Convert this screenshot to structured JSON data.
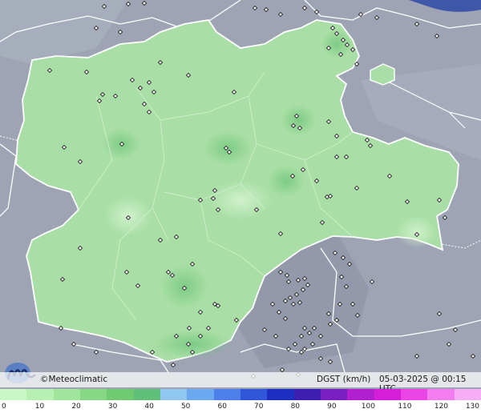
{
  "map": {
    "brand": "©Meteoclimatic",
    "variable": "DGST (km/h)",
    "date": "05-03-2025",
    "separator": "@",
    "time": "00:15 UTC",
    "colors": {
      "background_land": "#9ea4b4",
      "region_fill": "#a9dfa6",
      "border": "#ffffff"
    }
  },
  "legend": {
    "ticks": [
      "0",
      "10",
      "20",
      "30",
      "40",
      "50",
      "60",
      "70",
      "80",
      "90",
      "100",
      "110",
      "120",
      "130"
    ],
    "colors": [
      "#c8f7c5",
      "#b6f0b2",
      "#9fe59b",
      "#86d884",
      "#6fcb6f",
      "#5fc07a",
      "#8fc7f0",
      "#6aa8f0",
      "#4d7fe8",
      "#2f56d9",
      "#1c2fc0",
      "#3d1fb0",
      "#7a1fc0",
      "#b21fd0",
      "#d61fd8",
      "#ea44e6",
      "#f27cf0",
      "#f7aef6"
    ]
  }
}
